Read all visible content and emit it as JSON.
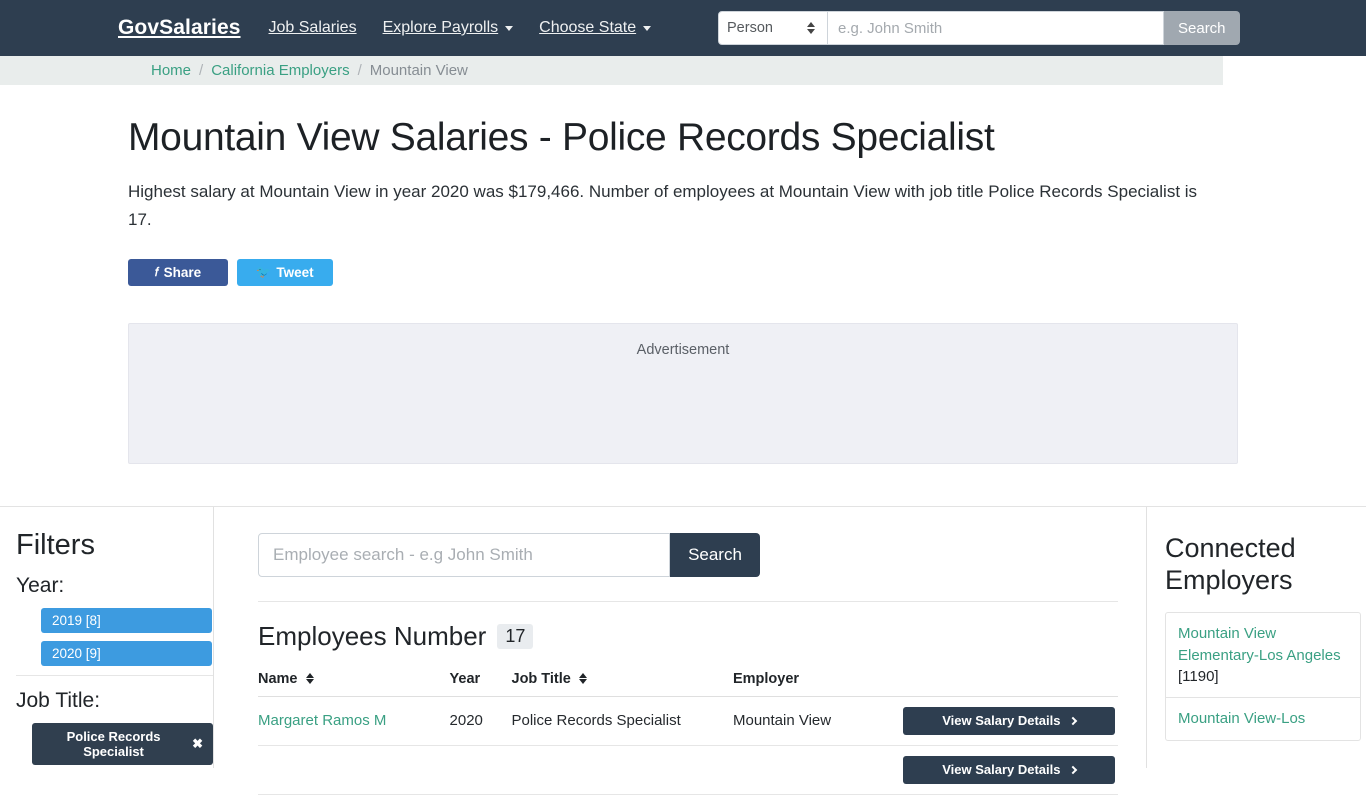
{
  "navbar": {
    "brand": "GovSalaries",
    "links": [
      {
        "label": "Job Salaries",
        "caret": false
      },
      {
        "label": "Explore Payrolls",
        "caret": true
      },
      {
        "label": "Choose State",
        "caret": true
      }
    ],
    "search": {
      "type_value": "Person",
      "placeholder": "e.g. John Smith",
      "value": "",
      "button": "Search"
    }
  },
  "breadcrumb": {
    "home": "Home",
    "employers": "California Employers",
    "current": "Mountain View",
    "separator": "/"
  },
  "hero": {
    "title": "Mountain View Salaries - Police Records Specialist",
    "description": "Highest salary at Mountain View in year 2020 was $179,466. Number of employees at Mountain View with job title Police Records Specialist is 17.",
    "share": {
      "facebook": "Share",
      "twitter": "Tweet"
    }
  },
  "advertisement": {
    "label": "Advertisement"
  },
  "filters": {
    "heading": "Filters",
    "year_label": "Year:",
    "years": [
      {
        "label": "2019 [8]"
      },
      {
        "label": "2020 [9]"
      }
    ],
    "job_title_label": "Job Title:",
    "job_title_chip": "Police Records Specialist",
    "chip_remove": "✖"
  },
  "main": {
    "search": {
      "placeholder": "Employee search - e.g John Smith",
      "value": "",
      "button": "Search"
    },
    "employees_heading": "Employees Number",
    "employees_count": "17",
    "columns": {
      "name": "Name",
      "year": "Year",
      "job_title": "Job Title",
      "employer": "Employer"
    },
    "rows": [
      {
        "name": "Margaret Ramos M",
        "year": "2020",
        "job_title": "Police Records Specialist",
        "employer": "Mountain View",
        "action": "View Salary Details"
      },
      {
        "name": "",
        "year": "",
        "job_title": "",
        "employer": "",
        "action": "View Salary Details"
      }
    ]
  },
  "connected": {
    "heading": "Connected Employers",
    "items": [
      {
        "link": "Mountain View Elementary-Los Angeles",
        "count": "[1190]"
      },
      {
        "link": "Mountain View-Los",
        "count": ""
      }
    ]
  },
  "colors": {
    "navy": "#2e3e50",
    "teal_link": "#3aa083",
    "blue_filter": "#3d9be0",
    "facebook": "#3b5998",
    "twitter": "#38acee"
  }
}
